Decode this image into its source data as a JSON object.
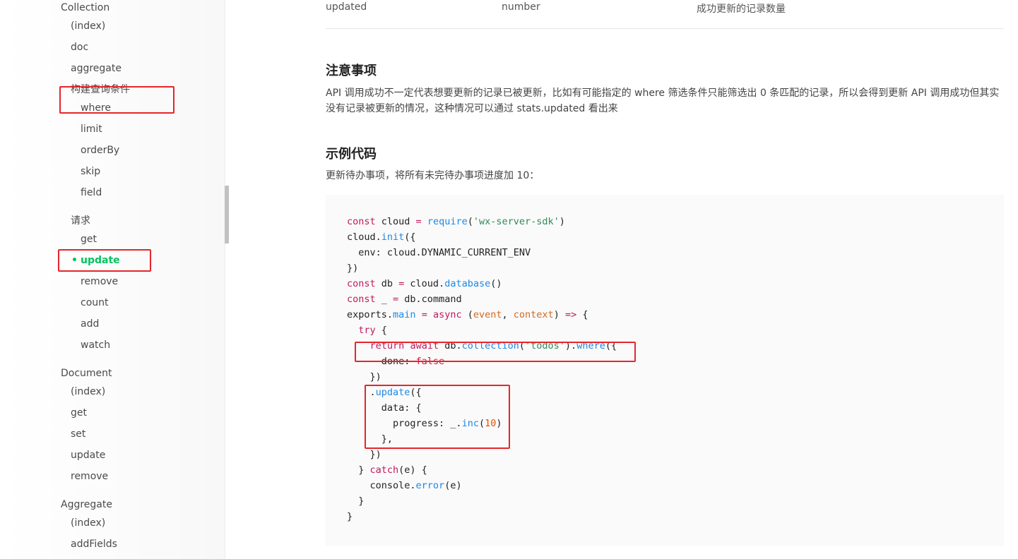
{
  "sidebar": {
    "items": [
      {
        "label": "Collection"
      },
      {
        "label": "(index)"
      },
      {
        "label": "doc"
      },
      {
        "label": "aggregate"
      },
      {
        "label": "构建查询条件"
      },
      {
        "label": "where"
      },
      {
        "label": "limit"
      },
      {
        "label": "orderBy"
      },
      {
        "label": "skip"
      },
      {
        "label": "field"
      },
      {
        "label": "请求"
      },
      {
        "label": "get"
      },
      {
        "label": "update"
      },
      {
        "label": "remove"
      },
      {
        "label": "count"
      },
      {
        "label": "add"
      },
      {
        "label": "watch"
      },
      {
        "label": "Document"
      },
      {
        "label": "(index)"
      },
      {
        "label": "get"
      },
      {
        "label": "set"
      },
      {
        "label": "update"
      },
      {
        "label": "remove"
      },
      {
        "label": "Aggregate"
      },
      {
        "label": "(index)"
      },
      {
        "label": "addFields"
      }
    ],
    "active_bullet": "•",
    "active_color": "#07c160"
  },
  "table": {
    "row": {
      "name": "updated",
      "type": "number",
      "desc": "成功更新的记录数量"
    }
  },
  "notes": {
    "title": "注意事项",
    "text": "API 调用成功不一定代表想要更新的记录已被更新，比如有可能指定的 where 筛选条件只能筛选出 0 条匹配的记录，所以会得到更新 API 调用成功但其实没有记录被更新的情况，这种情况可以通过 stats.updated 看出来"
  },
  "example": {
    "title": "示例代码",
    "desc": "更新待办事项，将所有未完待办事项进度加 10："
  },
  "annotation_color": "#e5262a"
}
